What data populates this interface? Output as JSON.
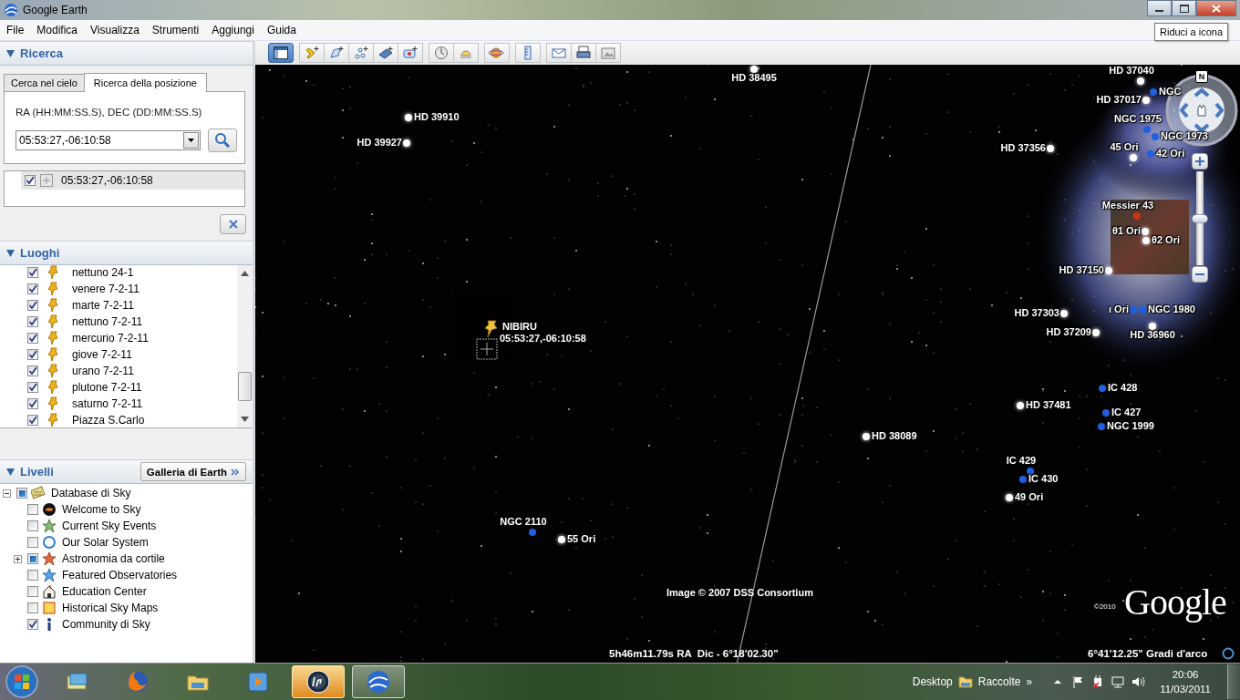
{
  "window": {
    "title": "Google Earth",
    "tooltip": "Riduci a icona"
  },
  "menu": [
    "File",
    "Modifica",
    "Visualizza",
    "Strumenti",
    "Aggiungi",
    "Guida"
  ],
  "toolbar": {
    "sidebar_toggle": {
      "selected": true
    }
  },
  "search": {
    "title": "Ricerca",
    "tabs": [
      {
        "label": "Cerca nel cielo",
        "selected": false
      },
      {
        "label": "Ricerca della posizione",
        "selected": true
      }
    ],
    "field_label": "RA (HH:MM:SS.S), DEC (DD:MM:SS.S)",
    "value": "05:53:27,-06:10:58",
    "results": [
      {
        "label": "05:53:27,-06:10:58",
        "checked": true
      }
    ]
  },
  "places": {
    "title": "Luoghi",
    "items": [
      {
        "label": "nettuno 24-1",
        "checked": true
      },
      {
        "label": "venere 7-2-11",
        "checked": true
      },
      {
        "label": "marte 7-2-11",
        "checked": true
      },
      {
        "label": "nettuno 7-2-11",
        "checked": true
      },
      {
        "label": "mercurio 7-2-11",
        "checked": true
      },
      {
        "label": "giove 7-2-11",
        "checked": true
      },
      {
        "label": "urano 7-2-11",
        "checked": true
      },
      {
        "label": "plutone 7-2-11",
        "checked": true
      },
      {
        "label": "saturno 7-2-11",
        "checked": true
      },
      {
        "label": "Piazza S.Carlo",
        "checked": true
      }
    ]
  },
  "layers": {
    "title": "Livelli",
    "gallery_button": "Galleria di Earth",
    "items": [
      {
        "label": "Database di Sky",
        "checked": false,
        "mixed": true,
        "expanded": true,
        "children": [
          {
            "label": "Welcome to Sky",
            "checked": false
          },
          {
            "label": "Current Sky Events",
            "checked": false
          },
          {
            "label": "Our Solar System",
            "checked": false
          },
          {
            "label": "Astronomia da cortile",
            "checked": false,
            "mixed": true,
            "expanded": false
          },
          {
            "label": "Featured Observatories",
            "checked": false
          },
          {
            "label": "Education Center",
            "checked": false
          },
          {
            "label": "Historical Sky Maps",
            "checked": false
          },
          {
            "label": "Community di Sky",
            "checked": true
          }
        ]
      }
    ]
  },
  "sky": {
    "labels": [
      {
        "label": "HD 38495",
        "color": "#ffffff"
      },
      {
        "label": "HD 37040",
        "color": "#ffffff"
      },
      {
        "label": "NGC",
        "color": "#2060e0"
      },
      {
        "label": "HD 39910",
        "color": "#ffffff"
      },
      {
        "label": "HD 37017",
        "color": "#ffffff"
      },
      {
        "label": "NGC 1975",
        "color": "#2060e0"
      },
      {
        "label": "NGC 1973",
        "color": "#2060e0"
      },
      {
        "label": "HD 39927",
        "color": "#ffffff"
      },
      {
        "label": "HD 37356",
        "color": "#ffffff"
      },
      {
        "label": "45 Ori",
        "color": "#ffffff"
      },
      {
        "label": "42 Ori",
        "color": "#2060e0"
      },
      {
        "label": "Messier 43",
        "color": "#d03020"
      },
      {
        "label": "θ1 Ori",
        "color": "#ffffff"
      },
      {
        "label": "θ2 Ori",
        "color": "#ffffff"
      },
      {
        "label": "HD 37150",
        "color": "#ffffff"
      },
      {
        "label": "ι Ori",
        "color": "#2060e0"
      },
      {
        "label": "NGC 1980",
        "color": "#2060e0"
      },
      {
        "label": "HD 37303",
        "color": "#ffffff"
      },
      {
        "label": "HD 36960",
        "color": "#ffffff"
      },
      {
        "label": "HD 37209",
        "color": "#ffffff"
      },
      {
        "label": "IC 428",
        "color": "#2060e0"
      },
      {
        "label": "HD 37481",
        "color": "#ffffff"
      },
      {
        "label": "IC 427",
        "color": "#2060e0"
      },
      {
        "label": "NGC 1999",
        "color": "#2060e0"
      },
      {
        "label": "HD 38089",
        "color": "#ffffff"
      },
      {
        "label": "IC 429",
        "color": "#2060e0"
      },
      {
        "label": "IC 430",
        "color": "#2060e0"
      },
      {
        "label": "49 Ori",
        "color": "#ffffff"
      },
      {
        "label": "NGC 2110",
        "color": "#2060e0"
      },
      {
        "label": "55 Ori",
        "color": "#ffffff"
      }
    ],
    "placemark": {
      "name": "NIBIRU",
      "coords": "05:53:27,-06:10:58"
    },
    "credit": "Image © 2007 DSS Consortium",
    "copyright": "©2010",
    "logo": "Google",
    "position": "5h46m11.79s RA  Dic - 6°18'02.30\"",
    "field_of_view": "6°41'12.25\" Gradi d'arco",
    "compass": "N",
    "zoom": {
      "level": 0.5
    }
  },
  "taskbar": {
    "apps": [
      {
        "running": false
      },
      {
        "running": false
      },
      {
        "running": false
      },
      {
        "running": false
      },
      {
        "running": true
      },
      {
        "running": true
      }
    ],
    "desktop": "Desktop",
    "collections": "Raccolte",
    "overflow": "»",
    "time": "20:06",
    "date": "11/03/2011"
  }
}
